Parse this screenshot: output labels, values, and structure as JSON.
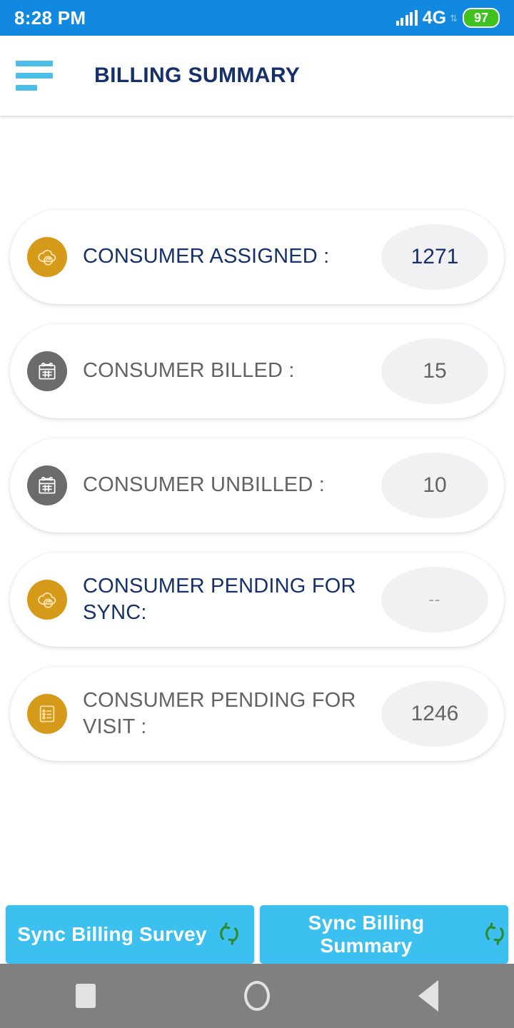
{
  "status_bar": {
    "time": "8:28 PM",
    "network_label": "4G",
    "battery_level": "97",
    "signal_icon": "signal-bars-icon",
    "data_arrows_icon": "data-transfer-arrows-icon",
    "background_color": "#1289e0"
  },
  "app_bar": {
    "menu_icon": "hamburger-menu-icon",
    "title": "BILLING SUMMARY",
    "title_color": "#15306b",
    "menu_color": "#4cbfe8"
  },
  "cards": [
    {
      "label": "CONSUMER ASSIGNED :",
      "value": "1271",
      "icon": "cloud-sync-icon",
      "icon_color": "#d69a1a",
      "label_color": "#15306b",
      "value_color": "#15306b"
    },
    {
      "label": "CONSUMER BILLED :",
      "value": "15",
      "icon": "calendar-icon",
      "icon_color": "#6b6b6b",
      "label_color": "#636363",
      "value_color": "#636363"
    },
    {
      "label": "CONSUMER UNBILLED :",
      "value": "10",
      "icon": "calendar-icon",
      "icon_color": "#6b6b6b",
      "label_color": "#636363",
      "value_color": "#636363"
    },
    {
      "label": "CONSUMER PENDING FOR SYNC:",
      "value": "--",
      "icon": "cloud-sync-icon",
      "icon_color": "#d69a1a",
      "label_color": "#15306b",
      "value_color": "#9a9a9a"
    },
    {
      "label": "CONSUMER PENDING FOR VISIT :",
      "value": "1246",
      "icon": "checklist-icon",
      "icon_color": "#d69a1a",
      "label_color": "#636363",
      "value_color": "#636363"
    }
  ],
  "buttons": [
    {
      "label": "Sync Billing Survey",
      "icon": "sync-arrows-icon",
      "color": "#3cc0f0"
    },
    {
      "label": "Sync Billing Summary",
      "icon": "sync-arrows-icon",
      "color": "#3cc0f0"
    }
  ],
  "nav_bar": {
    "recents_icon": "square-recents-icon",
    "home_icon": "circle-home-icon",
    "back_icon": "triangle-back-icon",
    "background_color": "#808080"
  }
}
